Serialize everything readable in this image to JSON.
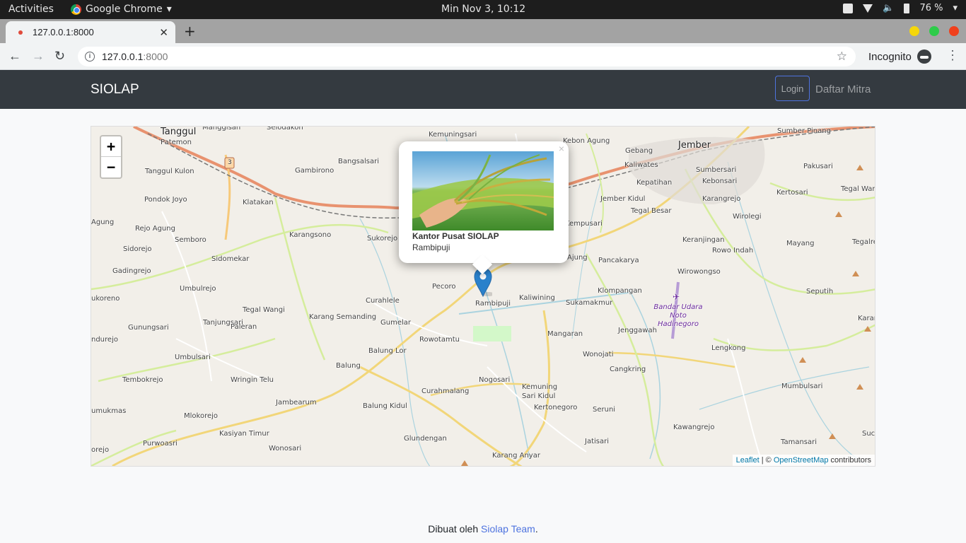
{
  "system": {
    "activities": "Activities",
    "app_name": "Google Chrome",
    "clock": "Min Nov  3, 10:12",
    "battery": "76 %"
  },
  "browser": {
    "tab_title": "127.0.0.1:8000",
    "url_host": "127.0.0.1",
    "url_port": ":8000",
    "profile": "Incognito"
  },
  "site": {
    "brand": "SIOLAP",
    "login": "Login",
    "mitra": "Daftar Mitra"
  },
  "map": {
    "popup_title": "Kantor Pusat SIOLAP",
    "popup_subtitle": "Rambipuji",
    "zoom_in": "+",
    "zoom_out": "−",
    "attribution_leaflet": "Leaflet",
    "attribution_sep": " | © ",
    "attribution_osm": "OpenStreetMap",
    "attribution_tail": " contributors",
    "road_shield": "3",
    "places": {
      "tanggul": "Tanggul",
      "manggisan": "Manggisan",
      "selodakon": "Selodakon",
      "patemon": "Patemon",
      "tanggul_kulon": "Tanggul Kulon",
      "gambirono": "Gambirono",
      "bangsalsari": "Bangsalsari",
      "kemuningsari": "Kemuningsari",
      "kebon_agung": "Kebon Agung",
      "gebang": "Gebang",
      "jember": "Jember",
      "sumber_pinang": "Sumber Pinang",
      "kaliwates": "Kaliwates",
      "sumbersari": "Sumbersari",
      "pakusari": "Pakusari",
      "kepatihan": "Kepatihan",
      "kebonsari": "Kebonsari",
      "kertosari": "Kertosari",
      "tegal_war": "Tegal War",
      "pondok_joyo": "Pondok Joyo",
      "klatakan": "Klatakan",
      "jember_kidul": "Jember Kidul",
      "karangrejo": "Karangrejo",
      "tegal_besar": "Tegal Besar",
      "wirolegi": "Wirolegi",
      "agung": "Agung",
      "rejo_agung": "Rejo Agung",
      "karangsono": "Karangsono",
      "sukorejo": "Sukorejo",
      "kempusari": "Kempusari",
      "keranjingan": "Keranjingan",
      "mayang": "Mayang",
      "tegalre": "Tegalre",
      "sidorejo": "Sidorejo",
      "semboro": "Semboro",
      "rowo_indah": "Rowo Indah",
      "sidomekar": "Sidomekar",
      "ajung": "Ajung",
      "pancakarya": "Pancakarya",
      "gadingrejo": "Gadingrejo",
      "wirowongso": "Wirowongso",
      "pecoro": "Pecoro",
      "umbulrejo": "Umbulrejo",
      "kaliwining": "Kaliwining",
      "klompangan": "Klompangan",
      "seputih": "Seputih",
      "ukoreno": "ukoreno",
      "curahlele": "Curahlele",
      "rambipuji": "Rambipuji",
      "sukamakmur": "Sukamakmur",
      "tegal_wangi": "Tegal Wangi",
      "airport": "Bandar Udara Noto Hadinegoro",
      "karang_semanding": "Karang Semanding",
      "tanjungsari": "Tanjungsari",
      "gunungsari": "Gunungsari",
      "paleran": "Paleran",
      "gumelar": "Gumelar",
      "jenggawah": "Jenggawah",
      "kara": "Karar",
      "mangaran": "Mangaran",
      "ndurejo": "ndurejo",
      "rowotamtu": "Rowotamtu",
      "balung_lor": "Balung Lor",
      "lengkong": "Lengkong",
      "umbulsari": "Umbulsari",
      "wonojati": "Wonojati",
      "tembokrejo": "Tembokrejo",
      "wringin_telu": "Wringin Telu",
      "balung": "Balung",
      "cangkring": "Cangkring",
      "nogosari": "Nogosari",
      "mumbulsari": "Mumbulsari",
      "kemuning_sari_kidul": "Kemuning Sari Kidul",
      "curahmalang": "Curahmalang",
      "jambearum": "Jambearum",
      "balung_kidul": "Balung Kidul",
      "kertonegoro": "Kertonegoro",
      "seruni": "Seruni",
      "umukmas": "umukmas",
      "mlokorejo": "Mlokorejo",
      "kawangrejo": "Kawangrejo",
      "kasiyan_timur": "Kasiyan Timur",
      "suc": "Suc",
      "purwoasri": "Purwoasri",
      "glundengan": "Glundengan",
      "tamansari": "Tamansari",
      "jatisari": "Jatisari",
      "orejo": "orejo",
      "wonosari": "Wonosari",
      "karang_anyar": "Karang Anyar"
    }
  },
  "footer": {
    "prefix": "Dibuat oleh ",
    "link": "Siolap Team",
    "suffix": "."
  }
}
